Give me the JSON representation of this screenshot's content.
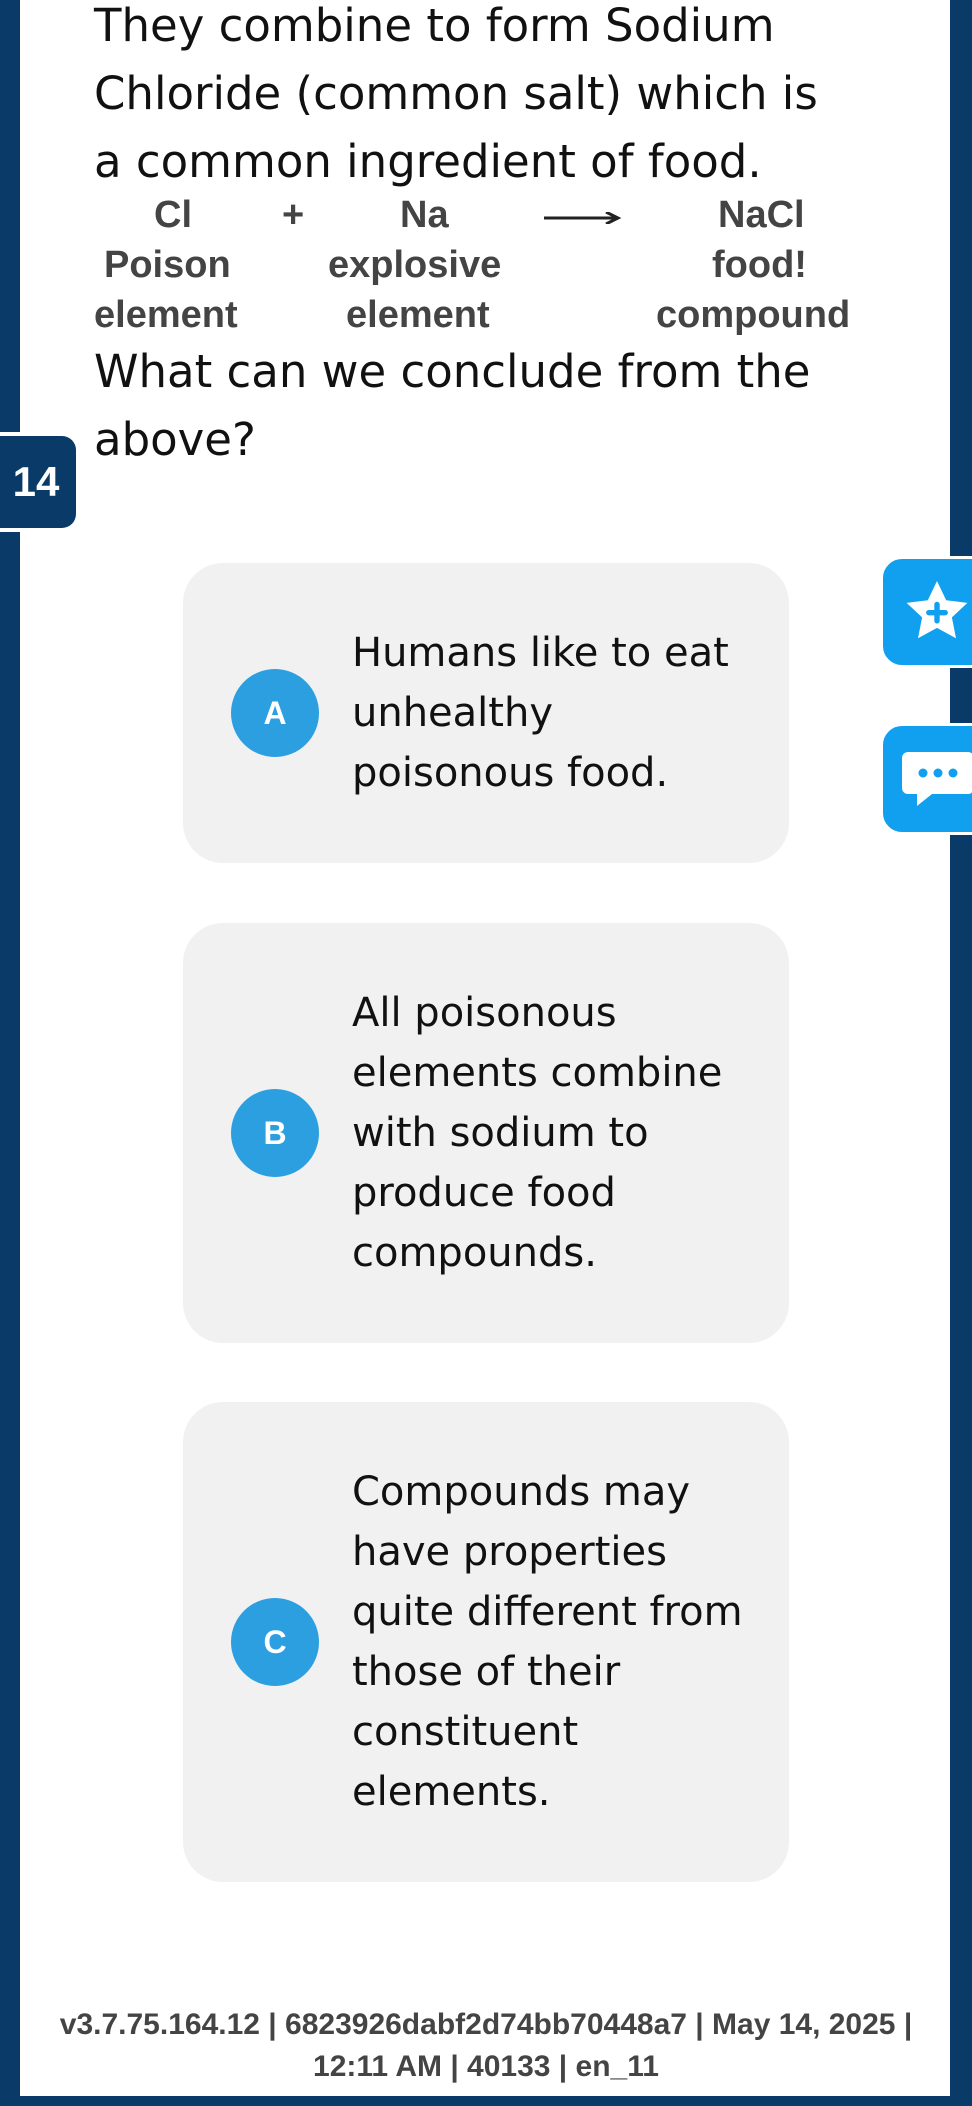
{
  "question": {
    "number": "14",
    "intro": "They combine to form Sodium Chloride (common salt) which is a common ingredient of food.",
    "prompt": "What can we conclude from the above?"
  },
  "equation": {
    "cl": "Cl",
    "plus": "+",
    "na": "Na",
    "nacl": "NaCl",
    "cl_desc1": "Poison",
    "cl_desc2": "element",
    "na_desc1": "explosive",
    "na_desc2": "element",
    "nacl_desc1": "food!",
    "nacl_desc2": "compound"
  },
  "options": [
    {
      "letter": "A",
      "text": "Humans like to eat unhealthy poisonous food."
    },
    {
      "letter": "B",
      "text": "All poisonous elements combine with sodium to produce food compounds."
    },
    {
      "letter": "C",
      "text": "Compounds may have properties quite different from those of their constituent elements."
    }
  ],
  "sidebar": {
    "star_icon": "star-plus-icon",
    "chat_icon": "chat-bubble-icon"
  },
  "footer": {
    "line1": "v3.7.75.164.12 | 6823926dabf2d74bb70448a7 | May 14, 2025 |",
    "line2": "12:11 AM | 40133 | en_11"
  },
  "colors": {
    "accent": "#2c9fe0",
    "sidebar": "#11a0f0",
    "frame": "#0a3a68",
    "option_bg": "#f1f1f1"
  }
}
